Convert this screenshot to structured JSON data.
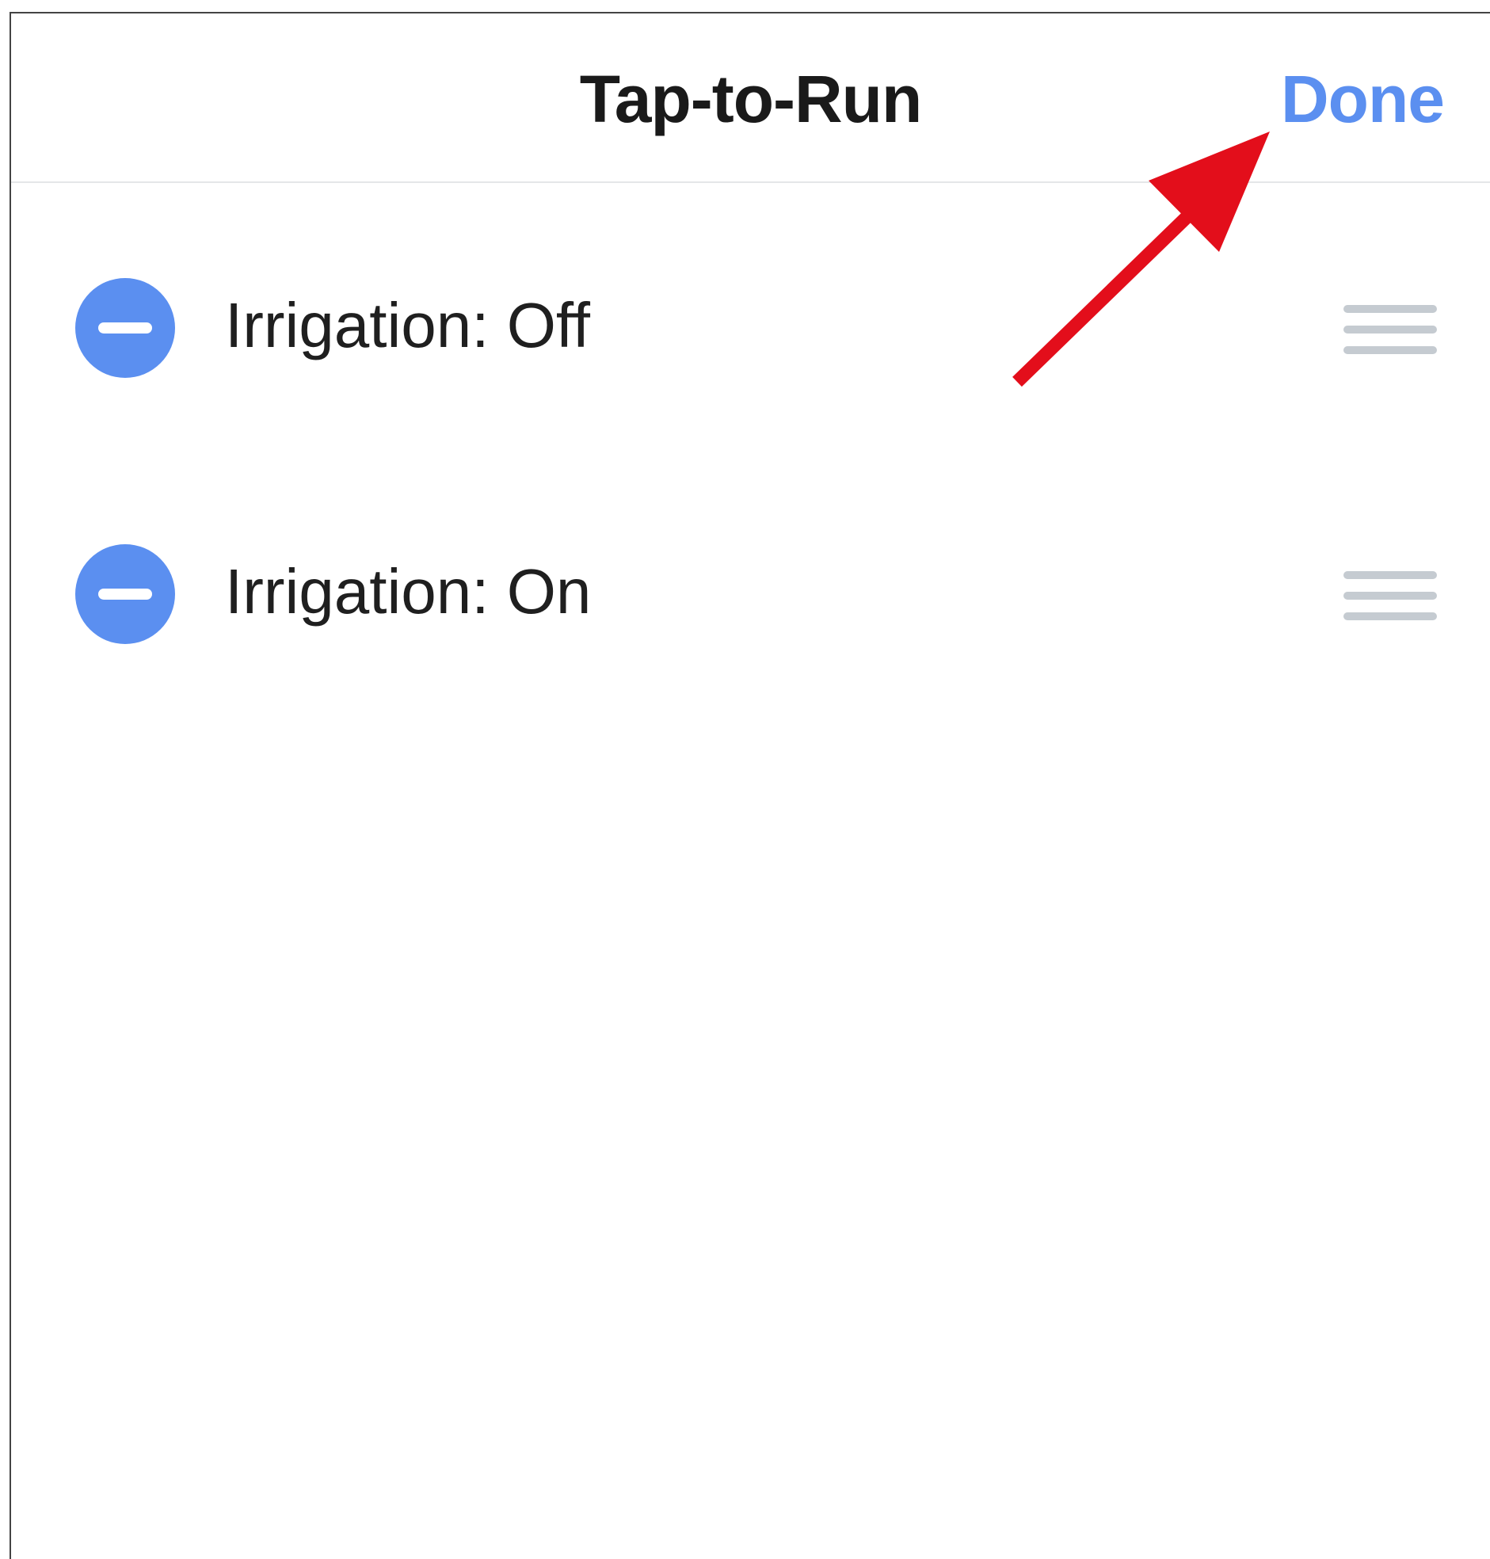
{
  "header": {
    "title": "Tap-to-Run",
    "done_label": "Done"
  },
  "list": {
    "items": [
      {
        "label": "Irrigation: Off"
      },
      {
        "label": "Irrigation: On"
      }
    ]
  },
  "icons": {
    "remove": "remove-circle-icon",
    "drag": "drag-handle-icon",
    "annotation": "red-arrow-icon"
  },
  "colors": {
    "accent": "#5b8ff0",
    "remove_button": "#5b8ff0",
    "drag_handle": "#c5cbd1",
    "annotation_arrow": "#e30e1b",
    "title_text": "#1a1a1a",
    "divider": "#e4e6e8"
  }
}
